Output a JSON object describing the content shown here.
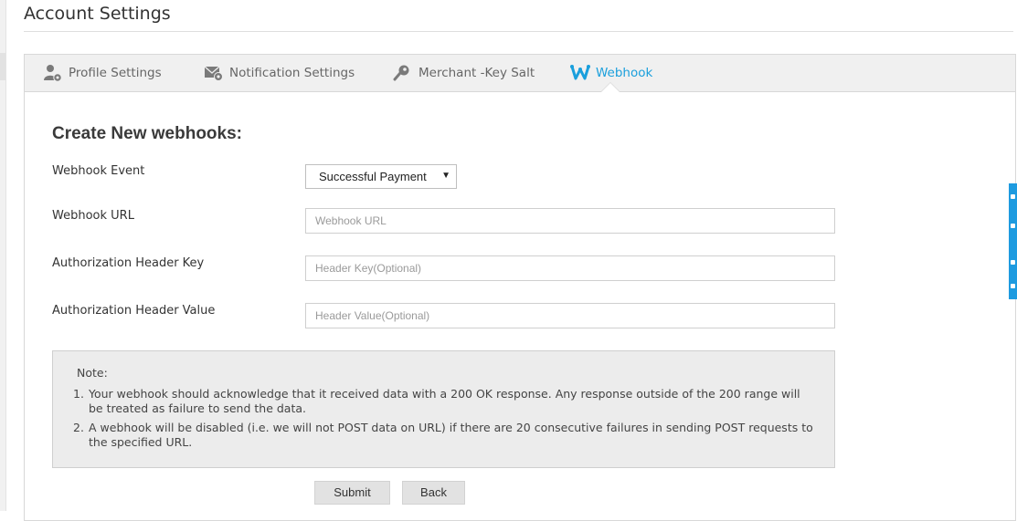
{
  "page": {
    "title": "Account Settings"
  },
  "tabs": [
    {
      "label": "Profile Settings",
      "icon": "user-gear-icon"
    },
    {
      "label": "Notification Settings",
      "icon": "envelope-gear-icon"
    },
    {
      "label": "Merchant -Key Salt",
      "icon": "key-icon"
    },
    {
      "label": "Webhook",
      "icon": "webhook-icon",
      "active": true
    }
  ],
  "form": {
    "heading": "Create New webhooks:",
    "event": {
      "label": "Webhook Event",
      "value": "Successful Payment"
    },
    "url": {
      "label": "Webhook URL",
      "placeholder": "Webhook URL"
    },
    "header_key": {
      "label": "Authorization Header Key",
      "placeholder": "Header Key(Optional)"
    },
    "header_value": {
      "label": "Authorization Header Value",
      "placeholder": "Header Value(Optional)"
    }
  },
  "note": {
    "title": "Note:",
    "items": [
      {
        "num": "1.",
        "text": "Your webhook should acknowledge that it received data with a 200 OK response. Any response outside of the 200 range will be treated as failure to send the data."
      },
      {
        "num": "2.",
        "text": "A webhook will be disabled (i.e. we will not POST data on URL) if there are 20 consecutive failures in sending POST requests to the specified URL."
      }
    ]
  },
  "buttons": {
    "submit": "Submit",
    "back": "Back"
  },
  "colors": {
    "accent": "#1a9fdc",
    "tab_text": "#666666",
    "tab_bar": "#f0f0f0",
    "note_bg": "#ececec",
    "button_bg": "#e2e2e2"
  }
}
